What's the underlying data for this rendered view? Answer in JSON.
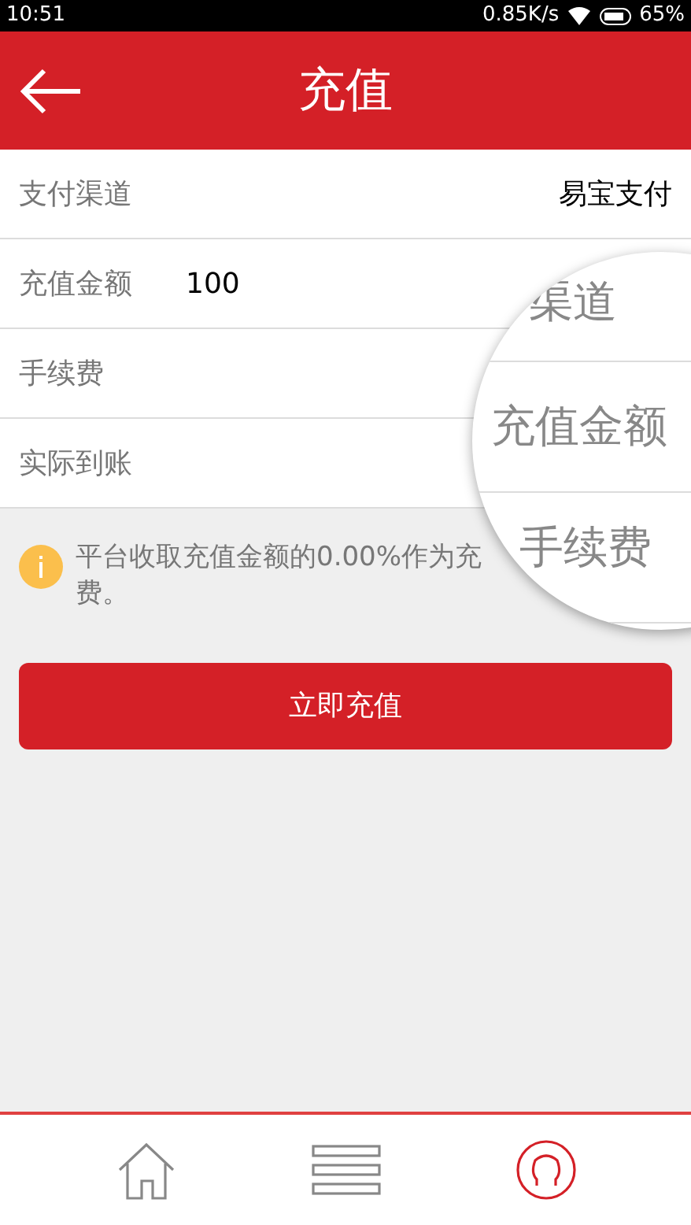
{
  "status_bar": {
    "time": "10:51",
    "speed": "0.85K/s",
    "battery": "65%"
  },
  "header": {
    "title": "充值"
  },
  "form_rows": [
    {
      "label": "支付渠道",
      "value": "易宝支付",
      "kind": "text"
    },
    {
      "label": "充值金额",
      "value": "100",
      "kind": "input"
    },
    {
      "label": "手续费",
      "kind": "text"
    },
    {
      "label": "实际到账",
      "kind": "text"
    }
  ],
  "notice": {
    "lines": [
      "平台收取充值金额的0.00%作为充",
      "费。"
    ]
  },
  "submit_button": "立即充值",
  "magnifier": {
    "labels": [
      "渠道",
      "充值金额",
      "手续费"
    ]
  },
  "bottom_nav": [
    {
      "kind": "home",
      "selected": false
    },
    {
      "kind": "menu",
      "selected": false
    },
    {
      "kind": "user",
      "selected": true
    }
  ]
}
